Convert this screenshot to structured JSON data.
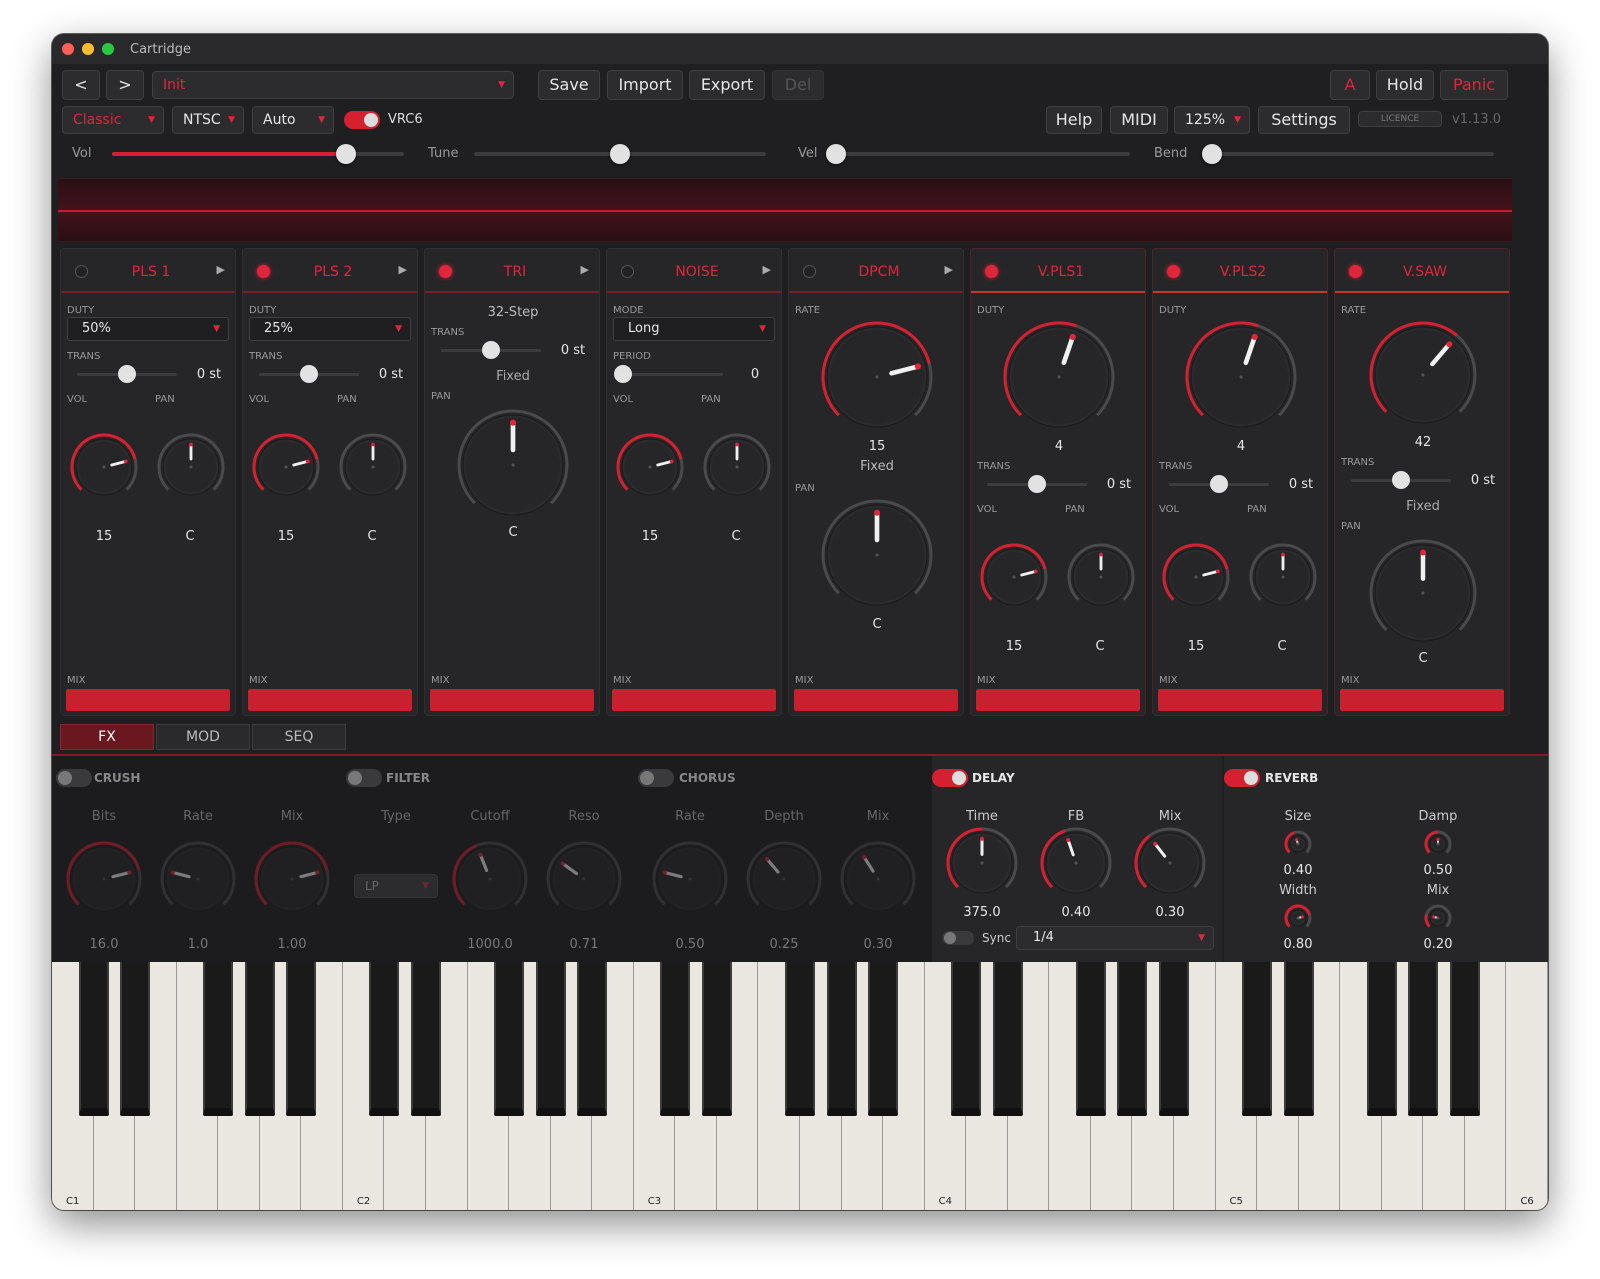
{
  "window": {
    "title": "Cartridge"
  },
  "toolbar": {
    "prev": "<",
    "next": ">",
    "preset": "Init",
    "save": "Save",
    "import": "Import",
    "export": "Export",
    "del": "Del",
    "a": "A",
    "hold": "Hold",
    "panic": "Panic"
  },
  "row2": {
    "mode": "Classic",
    "region": "NTSC",
    "auto": "Auto",
    "vrc6": "VRC6",
    "help": "Help",
    "midi": "MIDI",
    "zoom": "125%",
    "settings": "Settings",
    "licence": "LICENCE",
    "version": "v1.13.0"
  },
  "sliders": {
    "vol_label": "Vol",
    "tune_label": "Tune",
    "vel_label": "Vel",
    "bend_label": "Bend",
    "vol": 0.8,
    "tune": 0.5,
    "vel": 0.0,
    "bend": 0.0
  },
  "channels": [
    {
      "name": "PLS 1",
      "enabled": false,
      "duty_label": "DUTY",
      "duty": "50%",
      "trans_label": "TRANS",
      "trans": "0 st",
      "vol_label": "VOL",
      "pan_label": "PAN",
      "vol": "15",
      "pan": "C",
      "mix_label": "MIX"
    },
    {
      "name": "PLS 2",
      "enabled": true,
      "duty_label": "DUTY",
      "duty": "25%",
      "trans_label": "TRANS",
      "trans": "0 st",
      "vol_label": "VOL",
      "pan_label": "PAN",
      "vol": "15",
      "pan": "C",
      "mix_label": "MIX"
    },
    {
      "name": "TRI",
      "enabled": true,
      "mode": "32-Step",
      "trans_label": "TRANS",
      "trans": "0 st",
      "fixed": "Fixed",
      "pan_label": "PAN",
      "pan": "C",
      "mix_label": "MIX"
    },
    {
      "name": "NOISE",
      "enabled": false,
      "mode_label": "MODE",
      "mode": "Long",
      "period_label": "PERIOD",
      "period": "0",
      "vol_label": "VOL",
      "pan_label": "PAN",
      "vol": "15",
      "pan": "C",
      "mix_label": "MIX"
    },
    {
      "name": "DPCM",
      "enabled": false,
      "rate_label": "RATE",
      "rate": "15",
      "fixed": "Fixed",
      "pan_label": "PAN",
      "pan": "C",
      "mix_label": "MIX"
    },
    {
      "name": "V.PLS1",
      "enabled": true,
      "duty_label": "DUTY",
      "duty": "4",
      "trans_label": "TRANS",
      "trans": "0 st",
      "vol_label": "VOL",
      "pan_label": "PAN",
      "vol": "15",
      "pan": "C",
      "mix_label": "MIX"
    },
    {
      "name": "V.PLS2",
      "enabled": true,
      "duty_label": "DUTY",
      "duty": "4",
      "trans_label": "TRANS",
      "trans": "0 st",
      "vol_label": "VOL",
      "pan_label": "PAN",
      "vol": "15",
      "pan": "C",
      "mix_label": "MIX"
    },
    {
      "name": "V.SAW",
      "enabled": true,
      "rate_label": "RATE",
      "rate": "42",
      "trans_label": "TRANS",
      "trans": "0 st",
      "fixed": "Fixed",
      "pan_label": "PAN",
      "pan": "C",
      "mix_label": "MIX"
    }
  ],
  "tabs": {
    "fx": "FX",
    "mod": "MOD",
    "seq": "SEQ"
  },
  "fx": {
    "crush": {
      "title": "CRUSH",
      "bits_label": "Bits",
      "rate_label": "Rate",
      "mix_label": "Mix",
      "bits": "16.0",
      "rate": "1.0",
      "mix": "1.00"
    },
    "filter": {
      "title": "FILTER",
      "type_label": "Type",
      "cutoff_label": "Cutoff",
      "reso_label": "Reso",
      "type": "LP",
      "cutoff": "1000.0",
      "reso": "0.71"
    },
    "chorus": {
      "title": "CHORUS",
      "rate_label": "Rate",
      "depth_label": "Depth",
      "mix_label": "Mix",
      "rate": "0.50",
      "depth": "0.25",
      "mix": "0.30"
    },
    "delay": {
      "title": "DELAY",
      "time_label": "Time",
      "fb_label": "FB",
      "mix_label": "Mix",
      "time": "375.0",
      "fb": "0.40",
      "mix": "0.30",
      "sync_label": "Sync",
      "sync_value": "1/4"
    },
    "reverb": {
      "title": "REVERB",
      "size_label": "Size",
      "damp_label": "Damp",
      "width_label": "Width",
      "mix_label": "Mix",
      "size": "0.40",
      "damp": "0.50",
      "width": "0.80",
      "mix": "0.20"
    }
  },
  "keyboard": {
    "octaves": [
      "C1",
      "C2",
      "C3",
      "C4",
      "C5",
      "C6"
    ]
  },
  "colors": {
    "accent": "#d4202f",
    "panel": "#262628",
    "bg": "#1f1f21"
  }
}
